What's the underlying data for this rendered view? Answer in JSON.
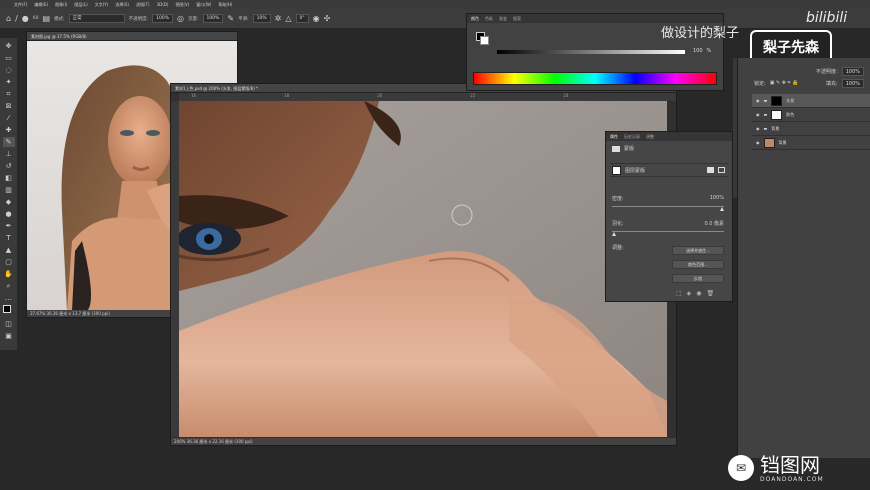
{
  "menubar": {
    "items": [
      "文件(F)",
      "编辑(E)",
      "图像(I)",
      "图层(L)",
      "文字(Y)",
      "选择(S)",
      "滤镜(T)",
      "3D(D)",
      "视图(V)",
      "窗口(W)",
      "帮助(H)"
    ]
  },
  "options": {
    "size": "60",
    "mode_label": "模式:",
    "mode_value": "正常",
    "opacity_label": "不透明度:",
    "opacity_value": "100%",
    "flow_label": "流量:",
    "flow_value": "100%",
    "smooth_label": "平滑:",
    "smooth_value": "10%",
    "angle_value": "0°"
  },
  "doc1": {
    "tab": "素材图.jpg @ 37.5% (RGB/8)",
    "status": "37.67%    36.36 厘米 x 13.7 厘米 (300 ppi)"
  },
  "doc2": {
    "tab": "素材1上色.psd @ 200% (头发, 图层蒙版/8) *",
    "status": "200%   36.36 厘米 x 22.16 厘米 (300 ppi)",
    "ruler_marks": [
      "16",
      "18",
      "20",
      "22",
      "24"
    ]
  },
  "color_panel": {
    "tabs": [
      "颜色",
      "色板",
      "渐变",
      "图案"
    ],
    "value": "100",
    "unit": "%"
  },
  "properties": {
    "tabs": [
      "属性",
      "历史记录",
      "调整"
    ],
    "header": "蒙版",
    "mask_label": "图层蒙版",
    "density_label": "密度:",
    "density_value": "100%",
    "feather_label": "羽化:",
    "feather_value": "0.0 像素",
    "adjust_label": "调整:",
    "btn_select_mask": "选择并遮住...",
    "btn_color_range": "颜色范围...",
    "btn_invert": "反相"
  },
  "layers": {
    "opacity_label": "不透明度:",
    "opacity_value": "100%",
    "fill_label": "填充:",
    "fill_value": "100%",
    "lock_label": "锁定:",
    "rows": [
      {
        "name": "头发",
        "kind": "mask"
      },
      {
        "name": "肤色",
        "kind": "mask"
      },
      {
        "name": "背景",
        "kind": "folder"
      },
      {
        "name": "背景",
        "kind": "image"
      }
    ]
  },
  "overlay": {
    "caption": "做设计的梨子",
    "brand": "梨子先森",
    "site": "bilibili"
  },
  "watermark": {
    "cn": "铛图网",
    "en": "DOANDOAN.COM"
  },
  "colors": {
    "accent": "#1e73e8",
    "panel": "#464646",
    "background": "#282828"
  }
}
